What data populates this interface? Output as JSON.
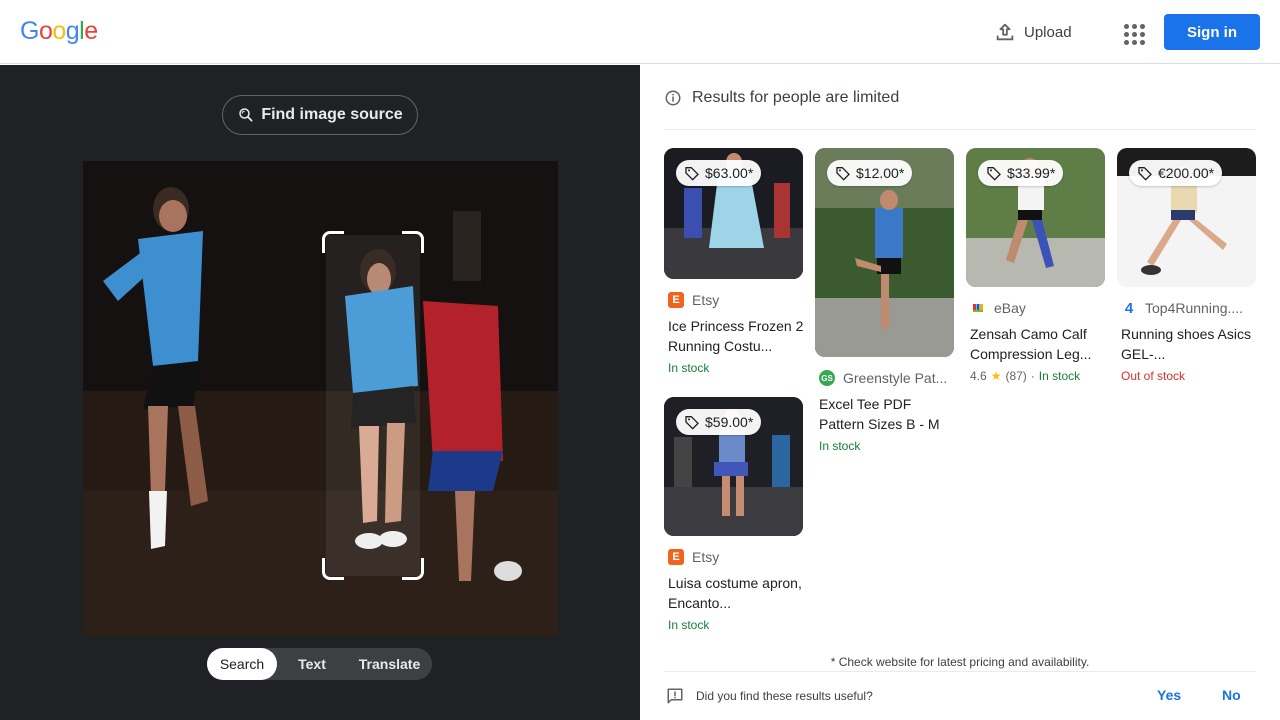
{
  "header": {
    "logo_letters": [
      "G",
      "o",
      "o",
      "g",
      "l",
      "e"
    ],
    "logo_colors": [
      "#4285F4",
      "#EA4335",
      "#FBBC05",
      "#4285F4",
      "#34A853",
      "#EA4335"
    ],
    "upload_label": "Upload",
    "signin_label": "Sign in",
    "accent": "#1a73e8"
  },
  "lens": {
    "find_source_label": "Find image source",
    "tabs": [
      {
        "label": "Search",
        "active": true
      },
      {
        "label": "Text",
        "active": false
      },
      {
        "label": "Translate",
        "active": false
      }
    ]
  },
  "results": {
    "notice": "Results for people are limited",
    "cards": [
      {
        "price": "$63.00*",
        "source": "Etsy",
        "source_icon": "etsy-icon",
        "source_color": "#F1641E",
        "title": "Ice Princess Frozen 2 Running Costu...",
        "stock": "In stock",
        "stock_status": "in"
      },
      {
        "price": "$12.00*",
        "source": "Greenstyle Pat...",
        "source_icon": "greenstyle-icon",
        "source_color": "#34A853",
        "title": "Excel Tee PDF Pattern Sizes B - M",
        "stock": "In stock",
        "stock_status": "in"
      },
      {
        "price": "$33.99*",
        "source": "eBay",
        "source_icon": "ebay-icon",
        "title": "Zensah Camo Calf Compression Leg...",
        "rating": "4.6",
        "reviews": "(87)",
        "stock": "In stock",
        "stock_status": "in"
      },
      {
        "price": "€200.00*",
        "source": "Top4Running....",
        "source_icon": "top4running-icon",
        "source_color": "#1a73e8",
        "title": "Running shoes Asics GEL-...",
        "stock": "Out of stock",
        "stock_status": "out"
      },
      {
        "price": "$59.00*",
        "source": "Etsy",
        "source_icon": "etsy-icon",
        "source_color": "#F1641E",
        "title": "Luisa costume apron, Encanto...",
        "stock": "In stock",
        "stock_status": "in"
      }
    ],
    "footnote": "* Check website for latest pricing and availability.",
    "feedback_question": "Did you find these results useful?",
    "yes_label": "Yes",
    "no_label": "No"
  }
}
